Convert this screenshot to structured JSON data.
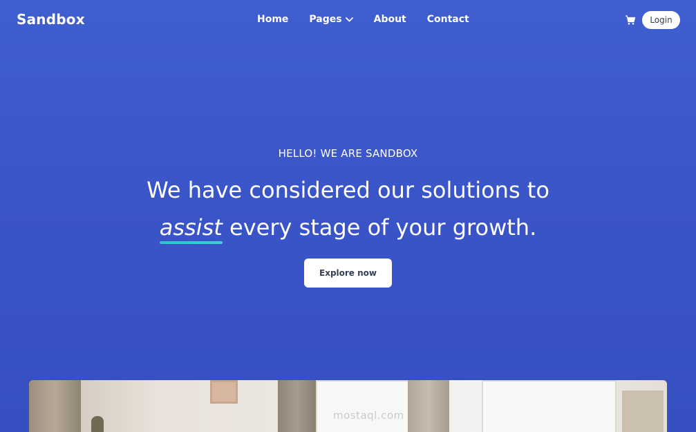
{
  "brand": {
    "name": "Sandbox"
  },
  "nav": {
    "home": "Home",
    "pages": "Pages",
    "about": "About",
    "contact": "Contact"
  },
  "header_actions": {
    "login": "Login"
  },
  "hero": {
    "eyebrow": "HELLO! WE ARE SANDBOX",
    "line1": "We have considered our solutions to",
    "accent": "assist",
    "line2_rest": " every stage of your growth.",
    "cta": "Explore now"
  },
  "photo": {
    "watermark": "mostaql.com"
  },
  "colors": {
    "background": "#3a55c8",
    "accent_underline": "#2ec5c9",
    "button_text": "#343f52"
  },
  "icons": [
    "chevron-down-icon",
    "cart-icon"
  ]
}
